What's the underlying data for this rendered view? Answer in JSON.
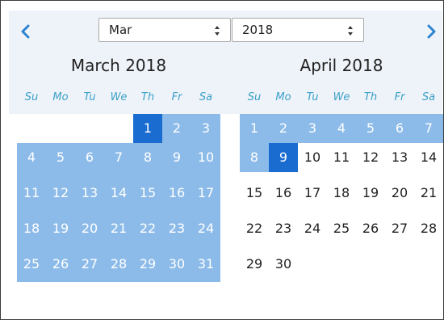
{
  "nav": {
    "prev_icon": "chevron-left-icon",
    "next_icon": "chevron-right-icon",
    "arrow_color": "#2e83d1"
  },
  "month_select": {
    "value": "Mar"
  },
  "year_select": {
    "value": "2018"
  },
  "left_calendar": {
    "title": "March 2018"
  },
  "right_calendar": {
    "title": "April 2018"
  },
  "weekdays": [
    "Su",
    "Mo",
    "Tu",
    "We",
    "Th",
    "Fr",
    "Sa"
  ],
  "march_weeks": [
    [
      "",
      "",
      "",
      "",
      "1",
      "2",
      "3"
    ],
    [
      "4",
      "5",
      "6",
      "7",
      "8",
      "9",
      "10"
    ],
    [
      "11",
      "12",
      "13",
      "14",
      "15",
      "16",
      "17"
    ],
    [
      "18",
      "19",
      "20",
      "21",
      "22",
      "23",
      "24"
    ],
    [
      "25",
      "26",
      "27",
      "28",
      "29",
      "30",
      "31"
    ]
  ],
  "april_weeks": [
    [
      "1",
      "2",
      "3",
      "4",
      "5",
      "6",
      "7"
    ],
    [
      "8",
      "9",
      "10",
      "11",
      "12",
      "13",
      "14"
    ],
    [
      "15",
      "16",
      "17",
      "18",
      "19",
      "20",
      "21"
    ],
    [
      "22",
      "23",
      "24",
      "25",
      "26",
      "27",
      "28"
    ],
    [
      "29",
      "30",
      "",
      "",
      "",
      "",
      ""
    ]
  ],
  "selection": {
    "start": "March 1, 2018",
    "end": "April 9, 2018"
  },
  "colors": {
    "range": "#8cbbe9",
    "active": "#1a6cd1",
    "weekday": "#3aa0c9",
    "header_bg": "#eef3f9"
  }
}
